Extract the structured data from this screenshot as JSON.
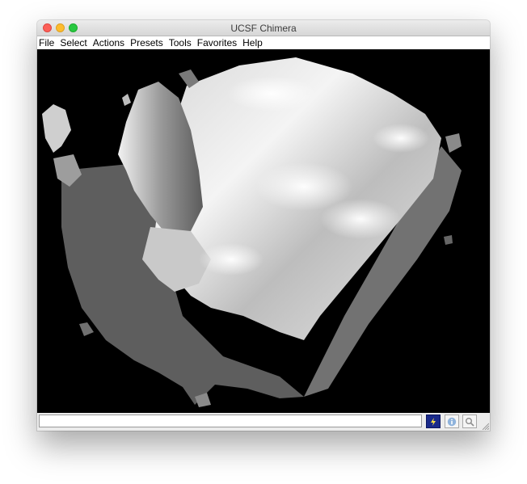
{
  "window": {
    "title": "UCSF Chimera"
  },
  "menu": {
    "items": [
      "File",
      "Select",
      "Actions",
      "Presets",
      "Tools",
      "Favorites",
      "Help"
    ]
  },
  "viewport": {
    "background": "#000000",
    "content": "volume-surface"
  },
  "command_line": {
    "value": "",
    "placeholder": ""
  },
  "toolbar": {
    "icons": [
      "command-line-icon",
      "info-icon",
      "magnifier-icon"
    ]
  },
  "colors": {
    "traffic_close": "#fc5f57",
    "traffic_minimize": "#fdbc2e",
    "traffic_maximize": "#28c840",
    "command_button": "#1a2a8a"
  }
}
